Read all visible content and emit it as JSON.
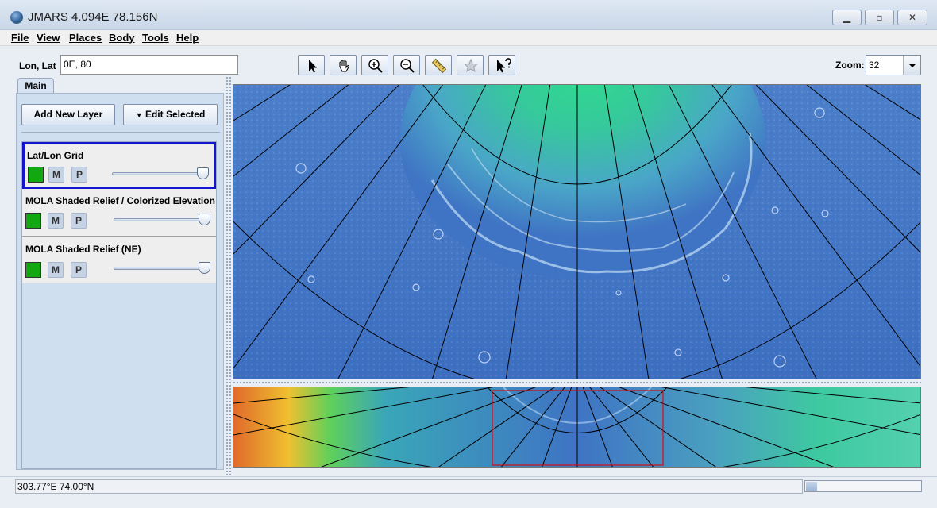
{
  "window": {
    "title": "JMARS 4.094E 78.156N",
    "minimize_glyph": "▁",
    "maximize_glyph": "▫",
    "close_glyph": "✕"
  },
  "menu": [
    "File",
    "View",
    "Places",
    "Body",
    "Tools",
    "Help"
  ],
  "location": {
    "label": "Lon, Lat",
    "value": "0E, 80"
  },
  "tabs": [
    {
      "label": "Main"
    }
  ],
  "panel_buttons": {
    "add_layer": "Add New Layer",
    "edit_selected": "Edit Selected",
    "edit_glyph": "▼"
  },
  "layers": [
    {
      "name": "Lat/Lon Grid",
      "m": "M",
      "p": "P",
      "opacity": 1.0,
      "selected": true
    },
    {
      "name": "MOLA Shaded Relief / Colorized Elevation",
      "m": "M",
      "p": "P",
      "opacity": 1.0,
      "selected": false
    },
    {
      "name": "MOLA Shaded Relief (NE)",
      "m": "M",
      "p": "P",
      "opacity": 1.0,
      "selected": false
    }
  ],
  "toolbar": {
    "tools": [
      "select-arrow-icon",
      "pan-hand-icon",
      "zoom-in-icon",
      "zoom-out-icon",
      "ruler-icon",
      "favorite-star-icon",
      "help-pointer-icon"
    ],
    "zoom_label": "Zoom:",
    "zoom_value": "32"
  },
  "status": {
    "coords": "303.77°E  74.00°N",
    "progress": 0.1
  },
  "colors": {
    "selection_border": "#1515cf",
    "layer_swatch": "#11a811",
    "viewport_box": "#d01010"
  }
}
